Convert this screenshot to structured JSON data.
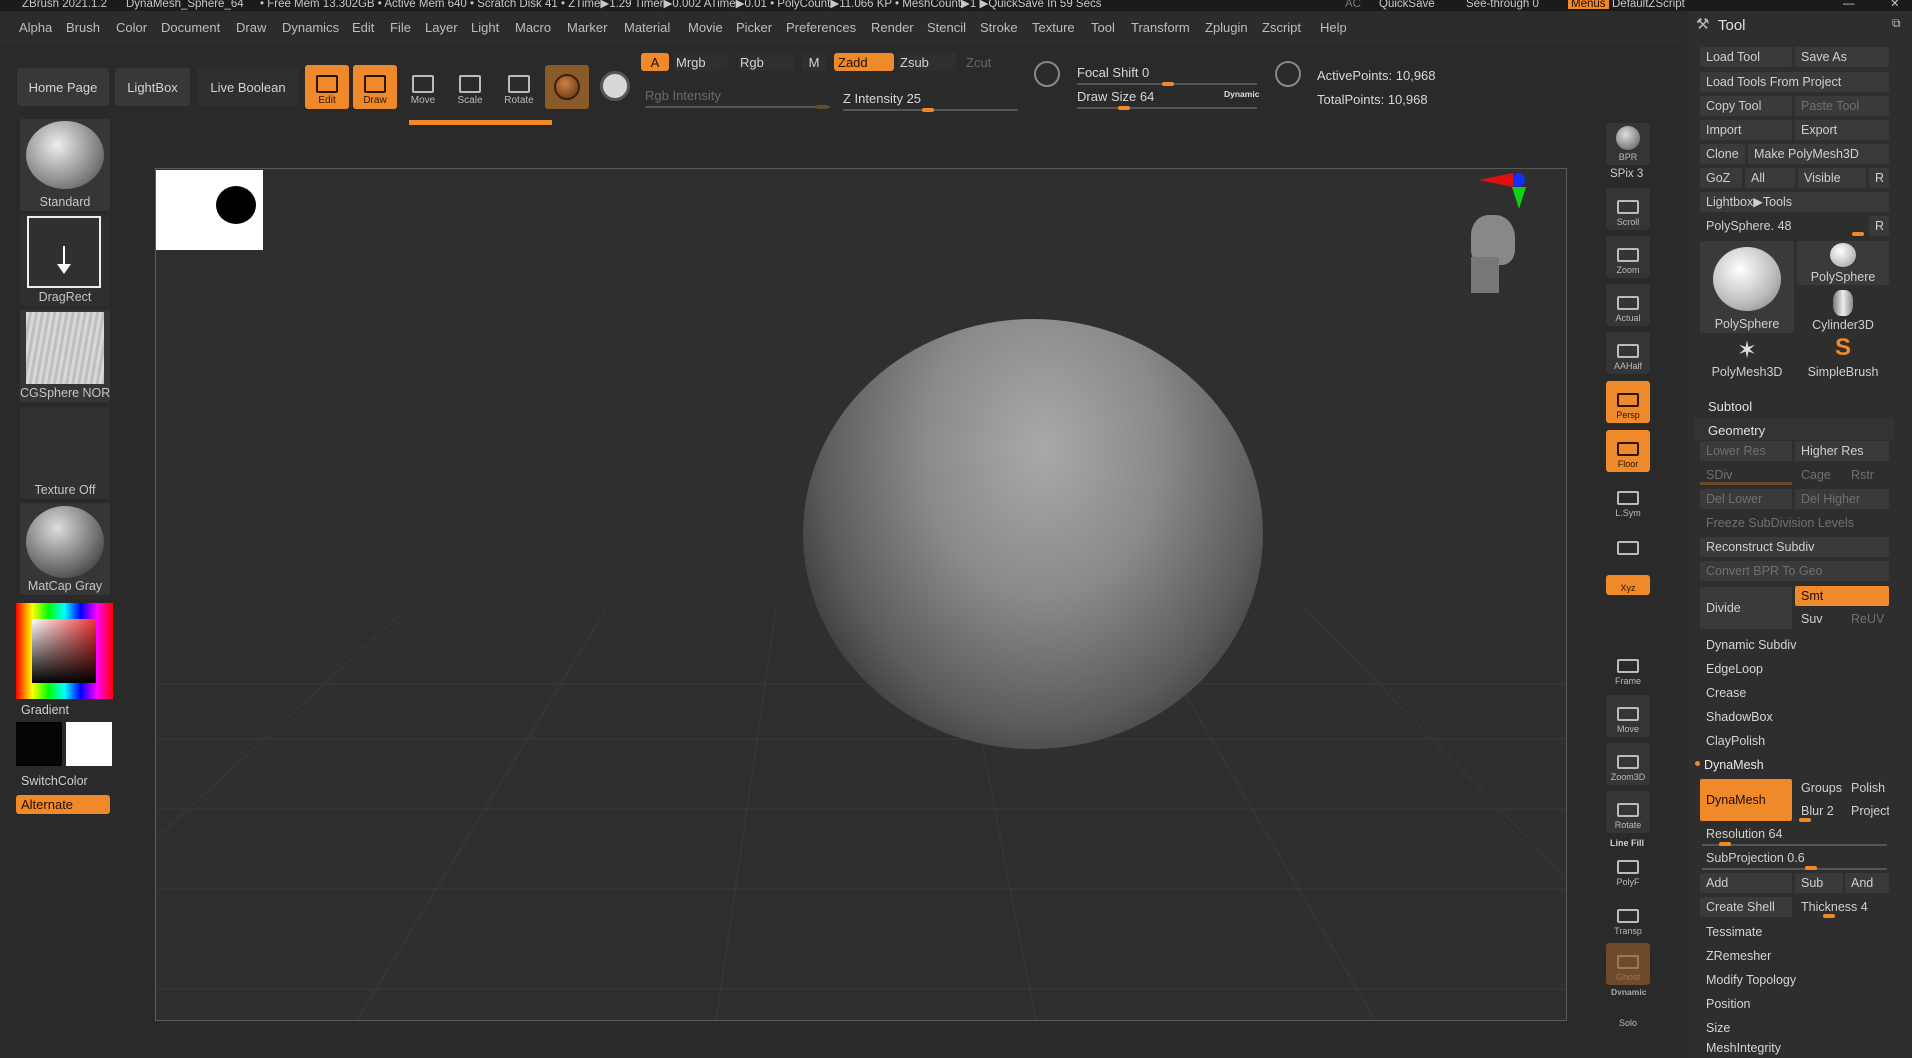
{
  "title_bar": {
    "app": "ZBrush 2021.1.2",
    "document": "DynaMesh_Sphere_64",
    "stats": "• Free Mem 13.302GB • Active Mem 640 • Scratch Disk 41 • ZTime▶1.29 Timer▶0.002 ATime▶0.01 • PolyCount▶11.066 KP • MeshCount▶1  ▶QuickSave In 59 Secs",
    "ac": "AC",
    "quicksave": "QuickSave",
    "see_through": "See-through  0",
    "menus": "Menus",
    "default_zscript": "DefaultZScript"
  },
  "menu": [
    "Alpha",
    "Brush",
    "Color",
    "Document",
    "Draw",
    "Dynamics",
    "Edit",
    "File",
    "Layer",
    "Light",
    "Macro",
    "Marker",
    "Material",
    "Movie",
    "Picker",
    "Preferences",
    "Render",
    "Stencil",
    "Stroke",
    "Texture",
    "Tool",
    "Transform",
    "Zplugin",
    "Zscript",
    "Help"
  ],
  "top": {
    "home_page": "Home Page",
    "lightbox": "LightBox",
    "live_boolean": "Live Boolean",
    "edit": "Edit",
    "draw": "Draw",
    "move": "Move",
    "scale": "Scale",
    "rotate": "Rotate",
    "a": "A",
    "mrgb": "Mrgb",
    "rgb": "Rgb",
    "m": "M",
    "zadd": "Zadd",
    "zsub": "Zsub",
    "zcut": "Zcut",
    "rgb_intensity": "Rgb Intensity",
    "z_intensity": "Z Intensity 25",
    "focal_shift": "Focal Shift 0",
    "draw_size": "Draw Size 64",
    "dynamic": "Dynamic",
    "active_points": "ActivePoints: 10,968",
    "total_points": "TotalPoints: 10,968"
  },
  "left": {
    "brush": "Standard",
    "stroke": "DragRect",
    "alpha": "CGSphere NORM",
    "texture": "Texture Off",
    "material": "MatCap Gray",
    "gradient": "Gradient",
    "switch_color": "SwitchColor",
    "alternate": "Alternate"
  },
  "right_shelf": [
    "BPR",
    "SPix 3",
    "Scroll",
    "Zoom",
    "Actual",
    "AAHalf",
    "Persp",
    "Floor",
    "L.Sym",
    "Lock",
    "Xyz",
    "Frame",
    "Move",
    "Zoom3D",
    "Rotate",
    "Line Fill",
    "PolyF",
    "Transp",
    "Ghost",
    "Dynamic",
    "Solo"
  ],
  "tool": {
    "header": "Tool",
    "load_tool": "Load Tool",
    "save_as": "Save As",
    "load_from_project": "Load Tools From Project",
    "copy_tool": "Copy Tool",
    "paste_tool": "Paste Tool",
    "import": "Import",
    "export": "Export",
    "clone": "Clone",
    "make_polymesh": "Make PolyMesh3D",
    "goz": "GoZ",
    "all": "All",
    "visible": "Visible",
    "r": "R",
    "lightbox_tools": "Lightbox▶Tools",
    "polysphere_slider": "PolySphere. 48",
    "thumbs": [
      "PolySphere",
      "PolySphere",
      "Cylinder3D",
      "PolyMesh3D",
      "SimpleBrush"
    ],
    "subtool": "Subtool",
    "geometry": "Geometry",
    "lower_res": "Lower Res",
    "higher_res": "Higher Res",
    "sdiv": "SDiv",
    "cage": "Cage",
    "rstr": "Rstr",
    "del_lower": "Del Lower",
    "del_higher": "Del Higher",
    "freeze": "Freeze SubDivision Levels",
    "reconstruct": "Reconstruct Subdiv",
    "convert_bpr": "Convert BPR To Geo",
    "divide": "Divide",
    "smt": "Smt",
    "suv": "Suv",
    "reuv": "ReUV",
    "dynamic_subdiv": "Dynamic Subdiv",
    "edgeloop": "EdgeLoop",
    "crease": "Crease",
    "shadowbox": "ShadowBox",
    "claypolish": "ClayPolish",
    "dynamesh_header": "DynaMesh",
    "dynamesh": "DynaMesh",
    "groups": "Groups",
    "polish": "Polish",
    "blur": "Blur 2",
    "project": "Project",
    "resolution": "Resolution 64",
    "subprojection": "SubProjection 0.6",
    "add": "Add",
    "sub": "Sub",
    "and": "And",
    "create_shell": "Create Shell",
    "thickness": "Thickness 4",
    "tessimate": "Tessimate",
    "zremesher": "ZRemesher",
    "modify_topology": "Modify Topology",
    "position": "Position",
    "size": "Size",
    "mesh_integrity": "MeshIntegrity"
  }
}
